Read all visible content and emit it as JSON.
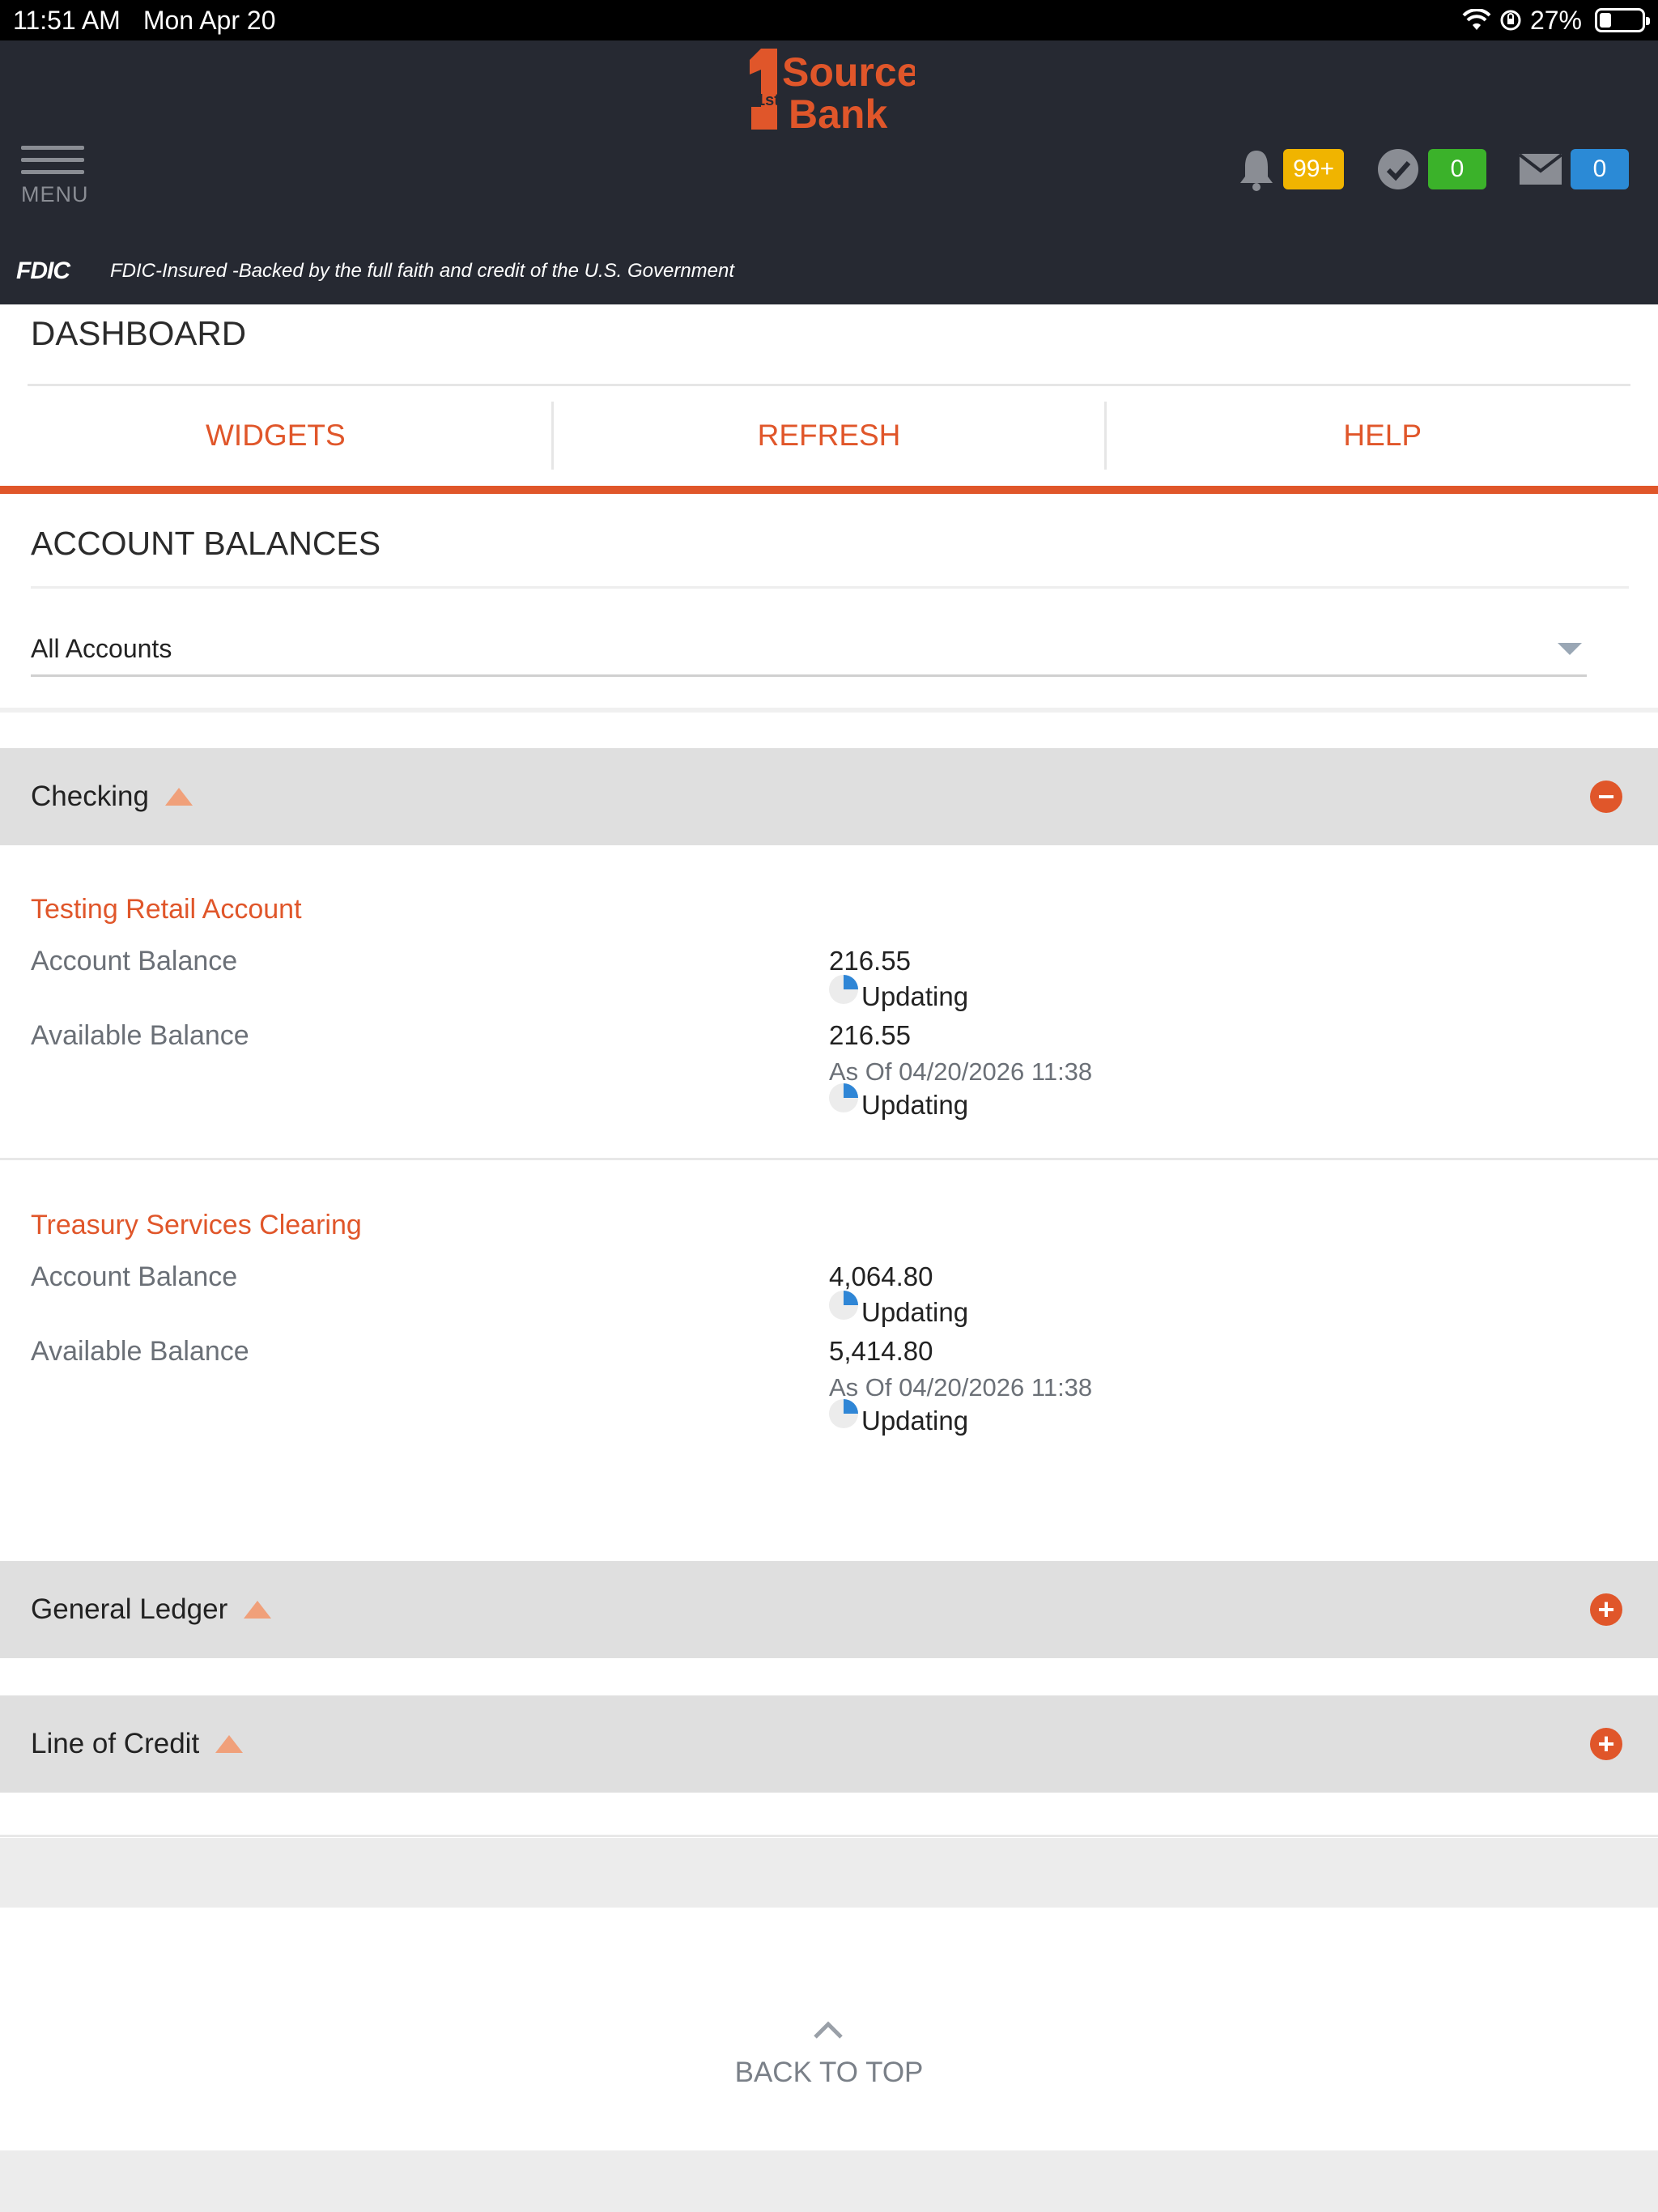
{
  "status_bar": {
    "time": "11:51 AM",
    "date": "Mon Apr 20",
    "battery": "27%",
    "battery_level": 0.27
  },
  "header": {
    "logo_text_top": "Source",
    "logo_text_bottom": "Bank",
    "logo_mark": "1st",
    "menu_label": "MENU",
    "notifications_count": "99+",
    "approvals_count": "0",
    "messages_count": "0",
    "fdic_logo": "FDIC",
    "fdic_text": "FDIC-Insured -Backed by the full faith and credit of the U.S. Government"
  },
  "dashboard": {
    "title": "DASHBOARD",
    "tabs": [
      {
        "label": "WIDGETS"
      },
      {
        "label": "REFRESH"
      },
      {
        "label": "HELP"
      }
    ]
  },
  "account_balances": {
    "title": "ACCOUNT BALANCES",
    "selected_filter": "All Accounts",
    "groups": [
      {
        "label": "Checking",
        "expanded": true
      },
      {
        "label": "General Ledger",
        "expanded": false
      },
      {
        "label": "Line of Credit",
        "expanded": false
      }
    ],
    "accounts": [
      {
        "name": "Testing Retail Account",
        "account_balance_label": "Account Balance",
        "account_balance": "216.55",
        "updating_1": "Updating",
        "available_balance_label": "Available Balance",
        "available_balance": "216.55",
        "as_of": "As Of 04/20/2026 11:38",
        "updating_2": "Updating"
      },
      {
        "name": "Treasury Services Clearing",
        "account_balance_label": "Account Balance",
        "account_balance": "4,064.80",
        "updating_1": "Updating",
        "available_balance_label": "Available Balance",
        "available_balance": "5,414.80",
        "as_of": "As Of 04/20/2026 11:38",
        "updating_2": "Updating"
      }
    ]
  },
  "footer": {
    "back_to_top": "BACK TO TOP"
  },
  "colors": {
    "accent": "#e0562a",
    "header_bg": "#262932",
    "badge_yellow": "#f0b400",
    "badge_green": "#3bb22a",
    "badge_blue": "#2b8ad6"
  }
}
